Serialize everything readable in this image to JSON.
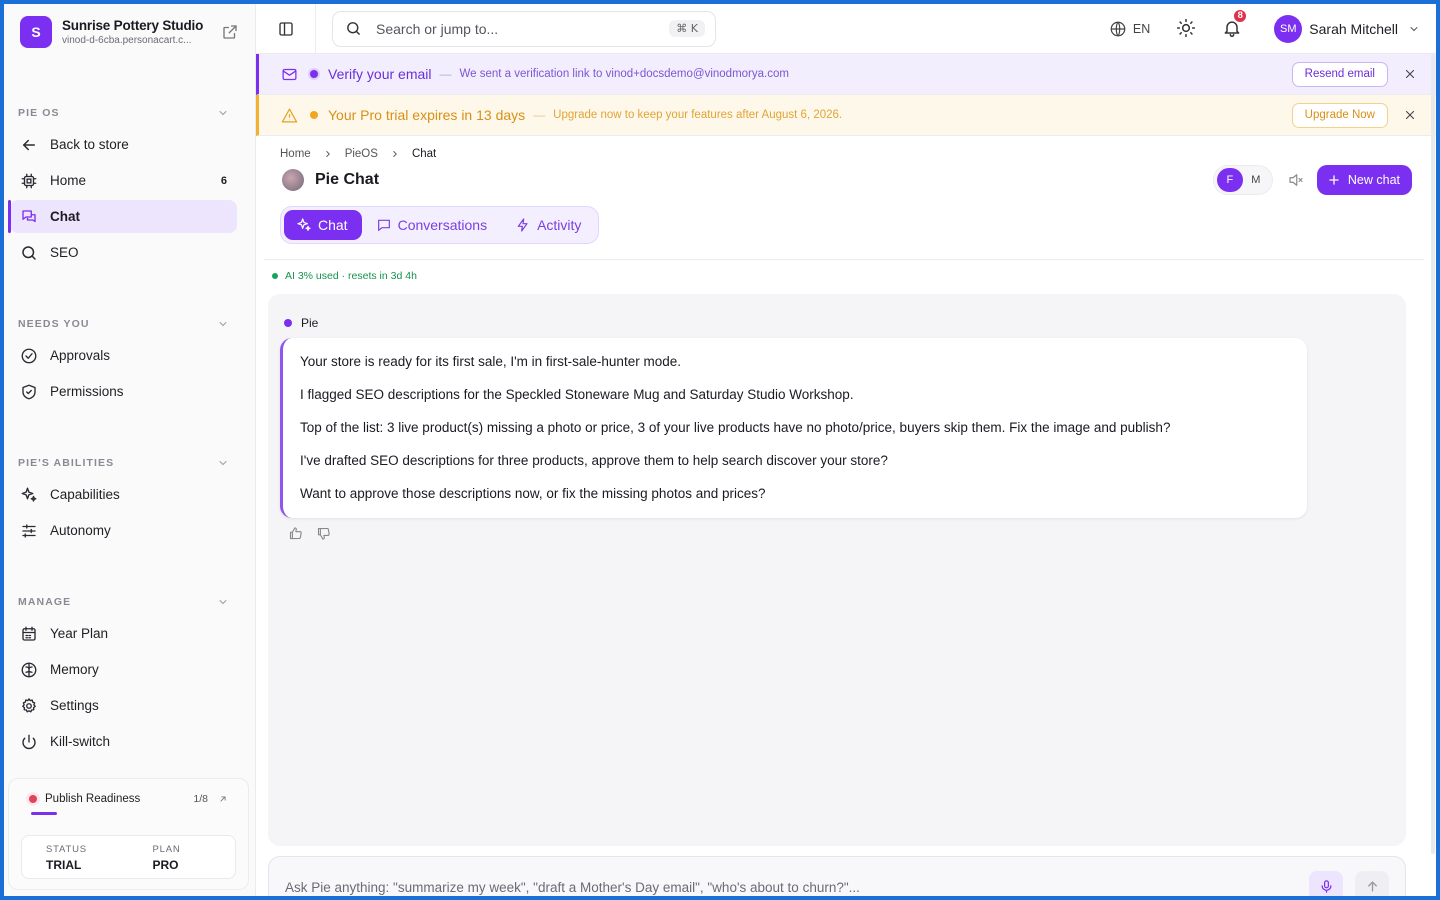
{
  "brand": {
    "initial": "S",
    "name": "Sunrise Pottery Studio",
    "url": "vinod-d-6cba.personacart.c..."
  },
  "sidebar": {
    "groups": [
      {
        "title": "PIE OS",
        "items": [
          {
            "label": "Back to store",
            "icon": "arrow-left-icon"
          },
          {
            "label": "Home",
            "icon": "chip-icon",
            "count": "6"
          },
          {
            "label": "Chat",
            "icon": "chat-bubbles-icon",
            "active": true
          },
          {
            "label": "SEO",
            "icon": "search-icon"
          }
        ]
      },
      {
        "title": "NEEDS YOU",
        "items": [
          {
            "label": "Approvals",
            "icon": "check-circle-icon"
          },
          {
            "label": "Permissions",
            "icon": "shield-check-icon"
          }
        ]
      },
      {
        "title": "PIE'S ABILITIES",
        "items": [
          {
            "label": "Capabilities",
            "icon": "sparkles-icon"
          },
          {
            "label": "Autonomy",
            "icon": "sliders-icon"
          }
        ]
      },
      {
        "title": "MANAGE",
        "items": [
          {
            "label": "Year Plan",
            "icon": "calendar-icon"
          },
          {
            "label": "Memory",
            "icon": "brain-icon"
          },
          {
            "label": "Settings",
            "icon": "gear-icon"
          },
          {
            "label": "Kill-switch",
            "icon": "power-icon"
          }
        ]
      }
    ],
    "readiness": {
      "label": "Publish Readiness",
      "count": "1/8",
      "progress": 0.125,
      "status_key": "STATUS",
      "status_value": "TRIAL",
      "plan_key": "PLAN",
      "plan_value": "PRO"
    }
  },
  "topbar": {
    "search_placeholder": "Search or jump to...",
    "shortcut": "⌘ K",
    "language": "EN",
    "notifications": "8",
    "user_initials": "SM",
    "user_name": "Sarah Mitchell"
  },
  "banners": {
    "verify": {
      "title": "Verify your email",
      "separator": "—",
      "description": "We sent a verification link to vinod+docsdemo@vinodmorya.com",
      "button": "Resend email"
    },
    "trial": {
      "title": "Your Pro trial expires in 13 days",
      "separator": "—",
      "description": "Upgrade now to keep your features after August 6, 2026.",
      "button": "Upgrade Now"
    }
  },
  "breadcrumb": [
    "Home",
    "PieOS",
    "Chat"
  ],
  "page": {
    "title": "Pie Chat",
    "toggle_f": "F",
    "toggle_m": "M",
    "new_chat": "New chat"
  },
  "tabs": [
    {
      "label": "Chat",
      "icon": "sparkles-icon",
      "active": true
    },
    {
      "label": "Conversations",
      "icon": "message-square-icon"
    },
    {
      "label": "Activity",
      "icon": "bolt-icon"
    }
  ],
  "usage": "AI 3% used · resets in 3d 4h",
  "chat": {
    "speaker": "Pie",
    "messages": [
      "Your store is ready for its first sale, I'm in first-sale-hunter mode.",
      "I flagged SEO descriptions for the Speckled Stoneware Mug and Saturday Studio Workshop.",
      "Top of the list: 3 live product(s) missing a photo or price, 3 of your live products have no photo/price, buyers skip them. Fix the image and publish?",
      "I've drafted SEO descriptions for three products, approve them to help search discover your store?",
      "Want to approve those descriptions now, or fix the missing photos and prices?"
    ]
  },
  "composer": {
    "placeholder": "Ask Pie anything: \"summarize my week\", \"draft a Mother's Day email\", \"who's about to churn?\"..."
  },
  "colors": {
    "accent": "#7b2ff0",
    "frame": "#1d6fd8",
    "trial": "#e7a020",
    "success": "#16a35a"
  }
}
